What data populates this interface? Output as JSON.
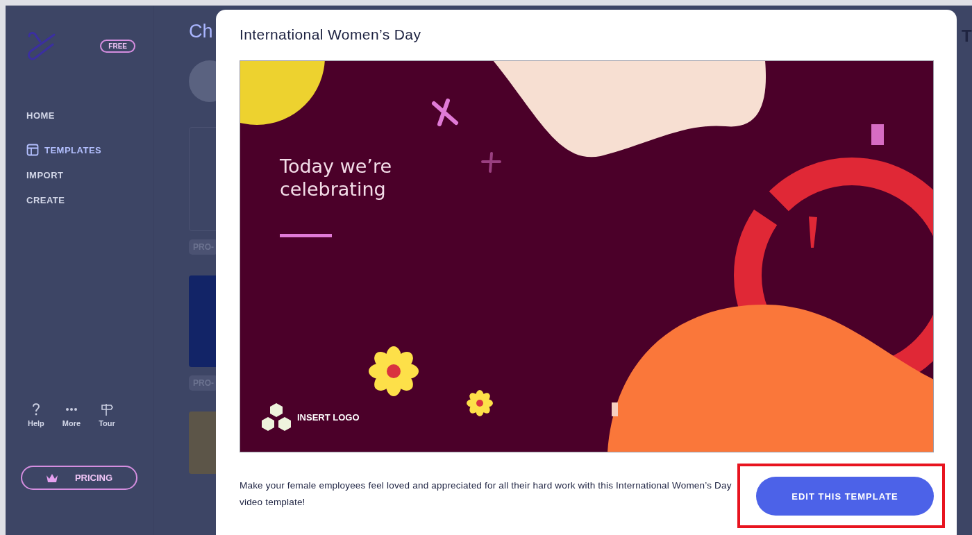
{
  "sidebar": {
    "badge": "FREE",
    "nav_items": [
      {
        "label": "HOME",
        "selected": false
      },
      {
        "label": "TEMPLATES",
        "selected": true
      },
      {
        "label": "IMPORT",
        "selected": false
      },
      {
        "label": "CREATE",
        "selected": false
      }
    ],
    "utility_items": [
      {
        "kind": "help",
        "label": "Help"
      },
      {
        "kind": "more",
        "label": "More"
      },
      {
        "kind": "tour",
        "label": "Tour"
      }
    ],
    "pricing_button": "PRICING"
  },
  "main_behind": {
    "heading": "Ch",
    "tags": [
      "PRO-",
      "PRO-"
    ]
  },
  "right_panel": {
    "heading": "T"
  },
  "modal": {
    "title": "International Women’s Day",
    "preview": {
      "headline_lines": [
        "Today we’re",
        "celebrating"
      ],
      "logo_label": "INSERT LOGO"
    },
    "description": "Make your female employees feel loved and appreciated for all their hard work with this International Women’s Day video template!",
    "button": "EDIT THIS TEMPLATE"
  }
}
